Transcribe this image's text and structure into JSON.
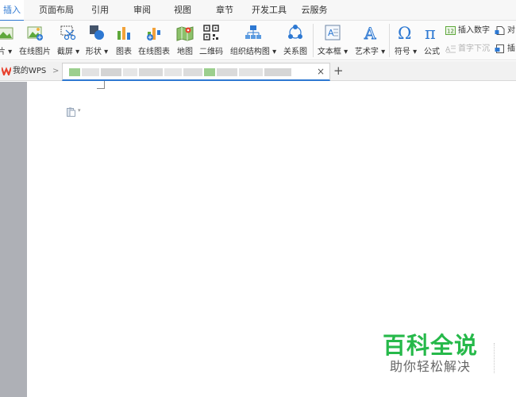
{
  "menu": {
    "tabs": [
      {
        "label": "插入",
        "active": true
      },
      {
        "label": "页面布局"
      },
      {
        "label": "引用"
      },
      {
        "label": "审阅"
      },
      {
        "label": "视图"
      },
      {
        "label": "章节"
      },
      {
        "label": "开发工具"
      },
      {
        "label": "云服务"
      }
    ]
  },
  "ribbon": {
    "tools": [
      {
        "label": "片 ▾",
        "icon": "picture-icon"
      },
      {
        "label": "在线图片",
        "icon": "online-picture-icon"
      },
      {
        "label": "截屏 ▾",
        "icon": "screenshot-icon"
      },
      {
        "label": "形状 ▾",
        "icon": "shapes-icon"
      },
      {
        "label": "图表",
        "icon": "chart-icon"
      },
      {
        "label": "在线图表",
        "icon": "online-chart-icon"
      },
      {
        "label": "地图",
        "icon": "map-icon"
      },
      {
        "label": "二维码",
        "icon": "qr-code-icon"
      },
      {
        "label": "组织结构图 ▾",
        "icon": "org-chart-icon"
      },
      {
        "label": "关系图",
        "icon": "relationship-diagram-icon"
      },
      {
        "label": "文本框 ▾",
        "icon": "text-box-icon"
      },
      {
        "label": "艺术字 ▾",
        "icon": "word-art-icon"
      },
      {
        "label": "符号 ▾",
        "icon": "omega-symbol-icon"
      },
      {
        "label": "公式",
        "icon": "pi-formula-icon"
      }
    ],
    "side_items": [
      {
        "label": "插入数字",
        "icon": "insert-number-icon"
      },
      {
        "label": "首字下沉",
        "icon": "drop-cap-icon",
        "disabled": true
      },
      {
        "label": "对",
        "icon": "object-icon"
      },
      {
        "label": "插",
        "icon": "insert-icon"
      }
    ]
  },
  "doc_tabs": {
    "home_label": "我的WPS",
    "home_arrow": ">",
    "close_glyph": "×",
    "new_tab_glyph": "+"
  },
  "watermark": {
    "title": "百科全说",
    "subtitle": "助你轻松解决"
  },
  "colors": {
    "accent": "#2d78d2",
    "watermark_green": "#26b94a",
    "wps_red": "#e8422e",
    "margin_grey": "#aeb0b6"
  }
}
